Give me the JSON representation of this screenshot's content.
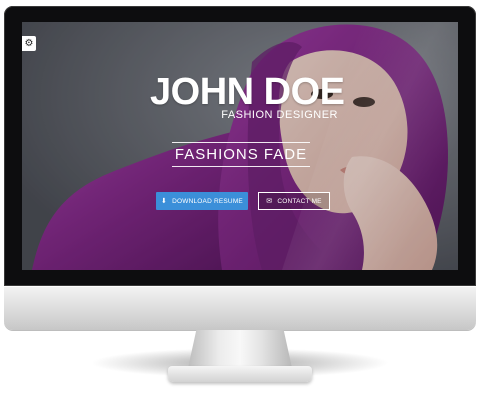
{
  "hero": {
    "name": "JOHN DOE",
    "subtitle": "FASHION DESIGNER",
    "tagline": "FASHIONS FADE"
  },
  "buttons": {
    "download": {
      "label": "DOWNLOAD RESUME",
      "icon": "download-icon"
    },
    "contact": {
      "label": "CONTACT ME",
      "icon": "envelope-icon"
    }
  },
  "menu_toggle": {
    "icon": "gear-icon"
  },
  "colors": {
    "accent": "#3b8fd9",
    "scarf": "#8a2a8f",
    "text": "#ffffff"
  }
}
